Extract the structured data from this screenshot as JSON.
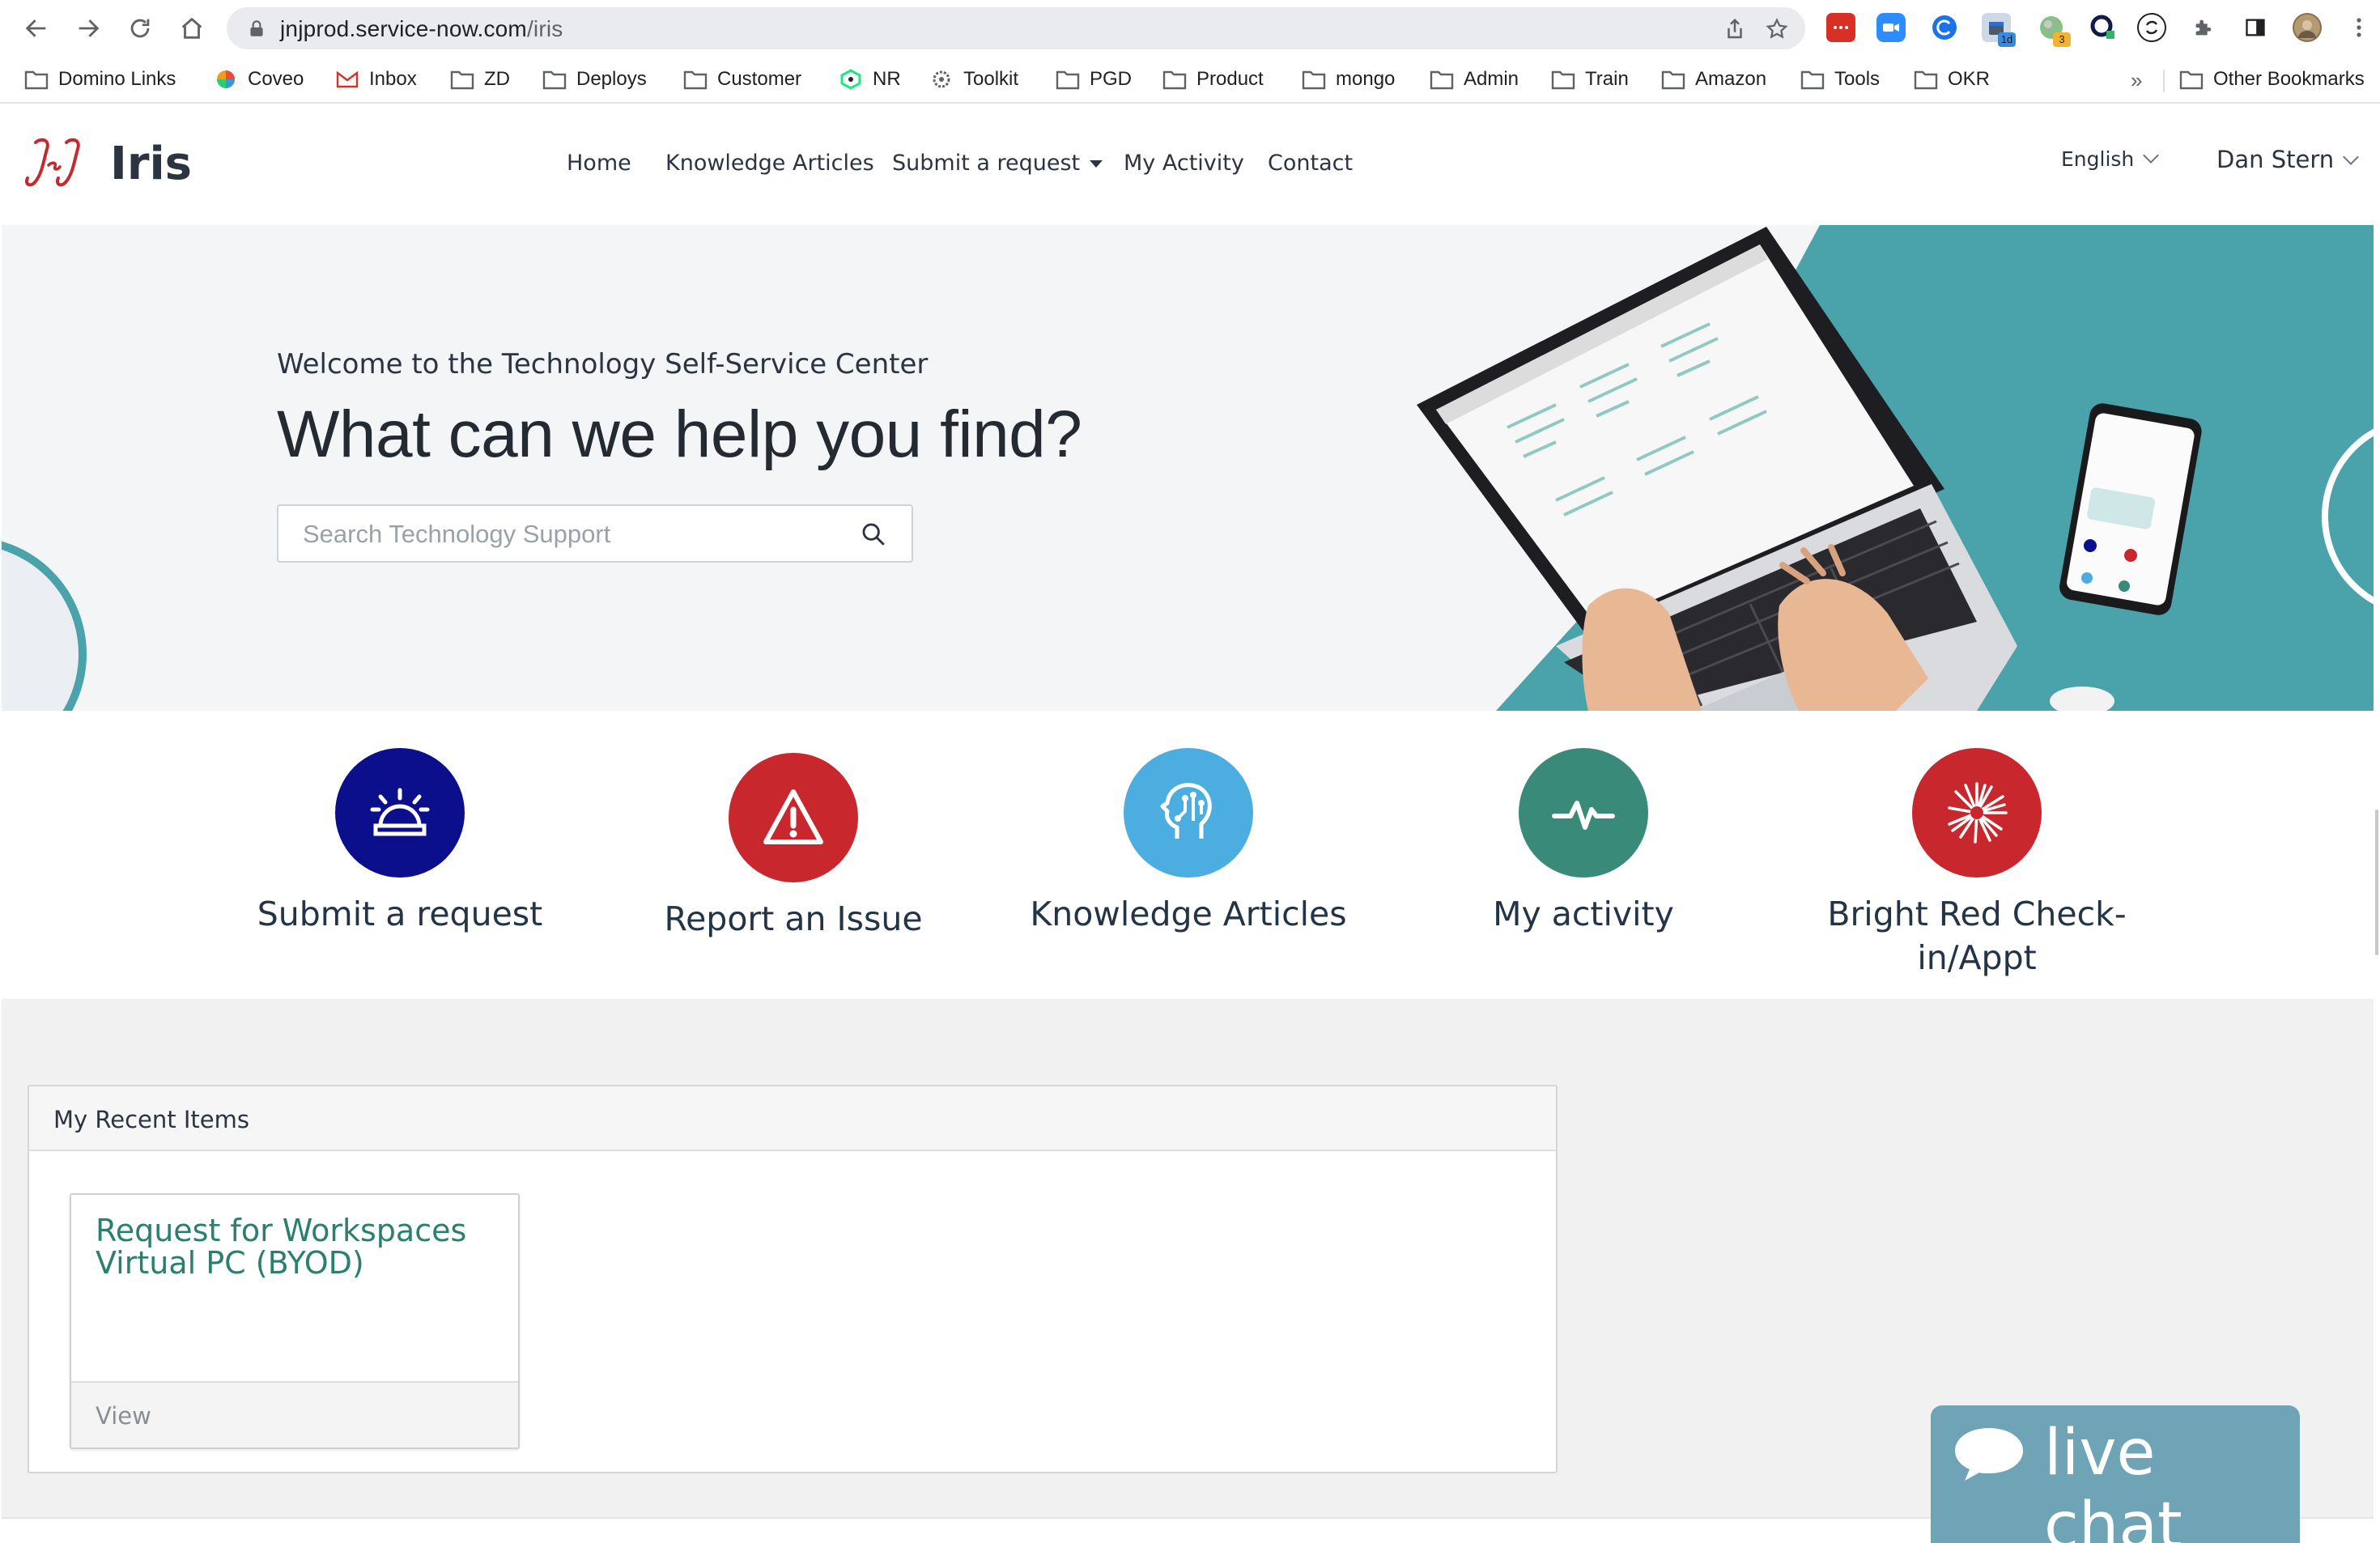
{
  "browser": {
    "url_host": "jnjprod.service-now.com",
    "url_path": "/iris",
    "extension_badges": {
      "calendar": "1d",
      "maps": "3"
    },
    "bookmarks": [
      "Domino Links",
      "Coveo",
      "Inbox",
      "ZD",
      "Deploys",
      "Customer",
      "NR",
      "Toolkit",
      "PGD",
      "Product",
      "mongo",
      "Admin",
      "Train",
      "Amazon",
      "Tools",
      "OKR"
    ],
    "bookmarks_overflow": "»",
    "other_bookmarks": "Other Bookmarks"
  },
  "site": {
    "logo_text": "Iris",
    "nav": [
      "Home",
      "Knowledge Articles",
      "Submit a request",
      "My Activity",
      "Contact"
    ],
    "language": "English",
    "user": "Dan Stern"
  },
  "hero": {
    "welcome": "Welcome to the Technology Self-Service Center",
    "title": "What can we help you find?",
    "search_placeholder": "Search Technology Support"
  },
  "tiles": [
    {
      "label": "Submit a request",
      "icon": "alarm-bell-icon",
      "color": "#0b0f8c"
    },
    {
      "label": "Report an Issue",
      "icon": "warning-icon",
      "color": "#c8282d"
    },
    {
      "label": "Knowledge Articles",
      "icon": "head-circuit-icon",
      "color": "#4cade0"
    },
    {
      "label": "My activity",
      "icon": "pulse-icon",
      "color": "#3a8a7a"
    },
    {
      "label": "Bright Red Check-in/Appt",
      "icon": "burst-icon",
      "color": "#c8282d"
    }
  ],
  "recent": {
    "title": "My Recent Items",
    "items": [
      {
        "title": "Request for Workspaces Virtual PC (BYOD)",
        "action": "View"
      }
    ]
  },
  "live_chat": {
    "label": "live chat",
    "color": "#6fa3b6"
  },
  "colors": {
    "teal": "#4aa3ab",
    "jj_red": "#c8282d",
    "link_green": "#2a7f6f"
  }
}
